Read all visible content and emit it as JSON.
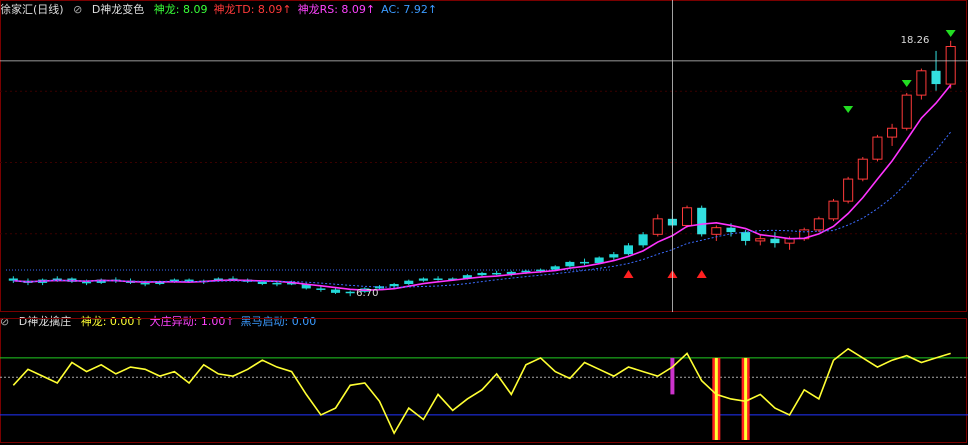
{
  "main_header": {
    "stock": "徐家汇(日线)",
    "indicator": "D神龙变色",
    "items": [
      {
        "label": "神龙:",
        "value": "8.09",
        "color": "#39ff39",
        "arrow": ""
      },
      {
        "label": "神龙TD:",
        "value": "8.09",
        "color": "#ff3a3a",
        "arrow": "↑"
      },
      {
        "label": "神龙RS:",
        "value": "8.09",
        "color": "#ff44ff",
        "arrow": "↑"
      },
      {
        "label": "AC:",
        "value": "7.92",
        "color": "#3b9bff",
        "arrow": "↑"
      }
    ]
  },
  "sub_header": {
    "indicator": "D神龙擒庄",
    "items": [
      {
        "label": "神龙:",
        "value": "0.00",
        "color": "#ffff33",
        "arrow": "↑"
      },
      {
        "label": "大庄异动:",
        "value": "1.00",
        "color": "#ff44ff",
        "arrow": "↑"
      },
      {
        "label": "黑马启动:",
        "value": "0.00",
        "color": "#3b9bff",
        "arrow": ""
      }
    ]
  },
  "chart_data": [
    {
      "type": "candlestick",
      "price_high_label": "18.26",
      "price_low_label": "6.70",
      "ylim": [
        6.3,
        19.2
      ],
      "crosshair_price": 17.35,
      "crosshair_index": 45,
      "x_count": 65,
      "candles": [
        [
          7.5,
          7.6,
          7.3,
          7.4
        ],
        [
          7.4,
          7.5,
          7.2,
          7.3
        ],
        [
          7.3,
          7.5,
          7.2,
          7.45
        ],
        [
          7.45,
          7.6,
          7.35,
          7.5
        ],
        [
          7.5,
          7.55,
          7.3,
          7.35
        ],
        [
          7.35,
          7.45,
          7.2,
          7.3
        ],
        [
          7.3,
          7.5,
          7.25,
          7.45
        ],
        [
          7.45,
          7.55,
          7.3,
          7.4
        ],
        [
          7.4,
          7.5,
          7.25,
          7.3
        ],
        [
          7.3,
          7.4,
          7.15,
          7.25
        ],
        [
          7.25,
          7.4,
          7.2,
          7.35
        ],
        [
          7.35,
          7.5,
          7.3,
          7.45
        ],
        [
          7.45,
          7.5,
          7.3,
          7.35
        ],
        [
          7.35,
          7.45,
          7.25,
          7.4
        ],
        [
          7.4,
          7.55,
          7.35,
          7.5
        ],
        [
          7.5,
          7.6,
          7.4,
          7.45
        ],
        [
          7.45,
          7.5,
          7.3,
          7.35
        ],
        [
          7.35,
          7.4,
          7.2,
          7.25
        ],
        [
          7.25,
          7.35,
          7.15,
          7.3
        ],
        [
          7.3,
          7.4,
          7.2,
          7.25
        ],
        [
          7.25,
          7.3,
          7.0,
          7.05
        ],
        [
          7.05,
          7.15,
          6.9,
          7.0
        ],
        [
          7.0,
          7.1,
          6.8,
          6.85
        ],
        [
          6.85,
          6.95,
          6.7,
          6.9
        ],
        [
          6.9,
          7.1,
          6.85,
          7.05
        ],
        [
          7.05,
          7.2,
          7.0,
          7.15
        ],
        [
          7.15,
          7.3,
          7.1,
          7.25
        ],
        [
          7.25,
          7.45,
          7.2,
          7.4
        ],
        [
          7.4,
          7.55,
          7.35,
          7.5
        ],
        [
          7.5,
          7.6,
          7.4,
          7.45
        ],
        [
          7.45,
          7.55,
          7.4,
          7.5
        ],
        [
          7.5,
          7.7,
          7.45,
          7.65
        ],
        [
          7.65,
          7.8,
          7.6,
          7.75
        ],
        [
          7.75,
          7.85,
          7.65,
          7.7
        ],
        [
          7.7,
          7.85,
          7.6,
          7.8
        ],
        [
          7.8,
          7.9,
          7.7,
          7.85
        ],
        [
          7.85,
          7.95,
          7.75,
          7.9
        ],
        [
          7.9,
          8.1,
          7.85,
          8.05
        ],
        [
          8.05,
          8.3,
          8.0,
          8.25
        ],
        [
          8.25,
          8.4,
          8.1,
          8.2
        ],
        [
          8.2,
          8.5,
          8.15,
          8.45
        ],
        [
          8.45,
          8.7,
          8.35,
          8.6
        ],
        [
          8.6,
          9.1,
          8.55,
          9.0
        ],
        [
          9.0,
          9.6,
          8.9,
          9.5
        ],
        [
          9.5,
          10.4,
          9.4,
          10.2
        ],
        [
          10.2,
          10.6,
          9.8,
          9.9
        ],
        [
          9.9,
          10.8,
          9.8,
          10.7
        ],
        [
          10.7,
          10.8,
          9.4,
          9.5
        ],
        [
          9.5,
          9.9,
          9.2,
          9.8
        ],
        [
          9.8,
          10.0,
          9.4,
          9.6
        ],
        [
          9.6,
          9.7,
          9.0,
          9.2
        ],
        [
          9.2,
          9.5,
          9.0,
          9.3
        ],
        [
          9.3,
          9.6,
          8.9,
          9.1
        ],
        [
          9.1,
          9.4,
          8.8,
          9.3
        ],
        [
          9.3,
          9.8,
          9.2,
          9.7
        ],
        [
          9.7,
          10.3,
          9.6,
          10.2
        ],
        [
          10.2,
          11.1,
          10.1,
          11.0
        ],
        [
          11.0,
          12.1,
          10.9,
          12.0
        ],
        [
          12.0,
          13.0,
          11.9,
          12.9
        ],
        [
          12.9,
          14.0,
          12.8,
          13.9
        ],
        [
          13.9,
          14.5,
          13.5,
          14.3
        ],
        [
          14.3,
          15.9,
          14.2,
          15.8
        ],
        [
          15.8,
          17.0,
          15.6,
          16.9
        ],
        [
          16.9,
          17.8,
          16.0,
          16.3
        ],
        [
          16.3,
          18.26,
          16.1,
          18.0
        ]
      ]
    },
    {
      "type": "line",
      "ylim": [
        0,
        100
      ],
      "x_count": 65,
      "yellow_series": [
        48,
        62,
        56,
        50,
        68,
        60,
        66,
        58,
        64,
        62,
        56,
        60,
        50,
        66,
        58,
        56,
        62,
        70,
        64,
        60,
        40,
        22,
        28,
        48,
        50,
        34,
        6,
        28,
        18,
        40,
        26,
        36,
        44,
        58,
        40,
        66,
        72,
        60,
        54,
        68,
        62,
        56,
        64,
        60,
        56,
        64,
        76,
        52,
        40,
        36,
        34,
        40,
        28,
        22,
        44,
        36,
        70,
        80,
        72,
        64,
        70,
        74,
        68,
        72,
        76
      ],
      "white_level": 55,
      "green_level": 72,
      "blue_level": 22
    }
  ]
}
